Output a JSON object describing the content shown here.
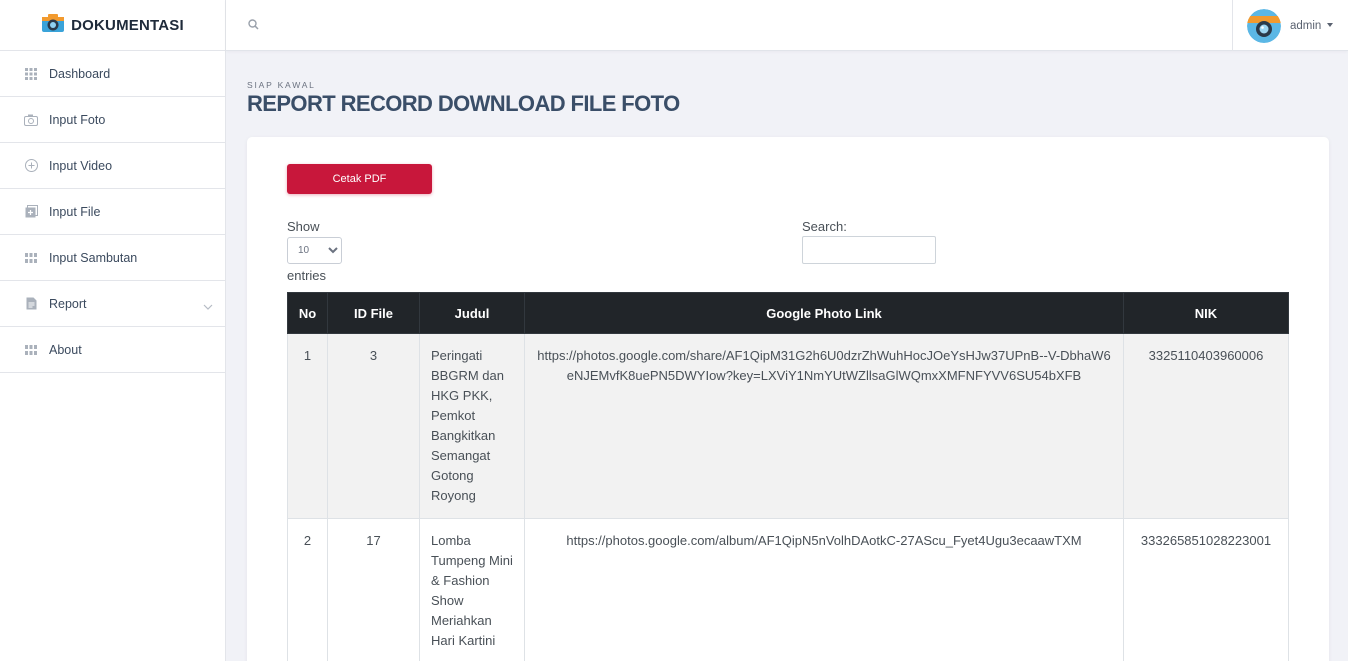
{
  "brand": {
    "name": "DOKUMENTASI",
    "icon": "camera-icon"
  },
  "sidebar": {
    "items": [
      {
        "label": "Dashboard",
        "icon": "grid-icon"
      },
      {
        "label": "Input Foto",
        "icon": "camera-icon"
      },
      {
        "label": "Input Video",
        "icon": "plus-circle-icon"
      },
      {
        "label": "Input File",
        "icon": "add-file-icon"
      },
      {
        "label": "Input Sambutan",
        "icon": "grid-icon"
      },
      {
        "label": "Report",
        "icon": "document-icon"
      },
      {
        "label": "About",
        "icon": "grid-icon"
      }
    ]
  },
  "header": {
    "search_icon": "search-icon",
    "user": {
      "name": "admin"
    }
  },
  "page": {
    "subtitle": "SIAP KAWAL",
    "title": "REPORT RECORD DOWNLOAD FILE FOTO"
  },
  "toolbar": {
    "pdf_label": "Cetak PDF"
  },
  "datatable": {
    "show_label": "Show",
    "length_value": "10",
    "entries_label": "entries",
    "search_label": "Search:"
  },
  "table": {
    "headers": [
      "No",
      "ID File",
      "Judul",
      "Google Photo Link",
      "NIK"
    ],
    "rows": [
      {
        "no": "1",
        "id_file": "3",
        "judul": "Peringati BBGRM dan HKG PKK, Pemkot Bangkitkan Semangat Gotong Royong",
        "link": "https://photos.google.com/share/AF1QipM31G2h6U0dzrZhWuhHocJOeYsHJw37UPnB--V-DbhaW6eNJEMvfK8uePN5DWYIow?key=LXViY1NmYUtWZllsaGlWQmxXMFNFYVV6SU54bXFB",
        "nik": "3325110403960006"
      },
      {
        "no": "2",
        "id_file": "17",
        "judul": "Lomba Tumpeng Mini & Fashion Show Meriahkan Hari Kartini",
        "link": "https://photos.google.com/album/AF1QipN5nVolhDAotkC-27AScu_Fyet4Ugu3ecaawTXM",
        "nik": "333265851028223001"
      }
    ]
  }
}
